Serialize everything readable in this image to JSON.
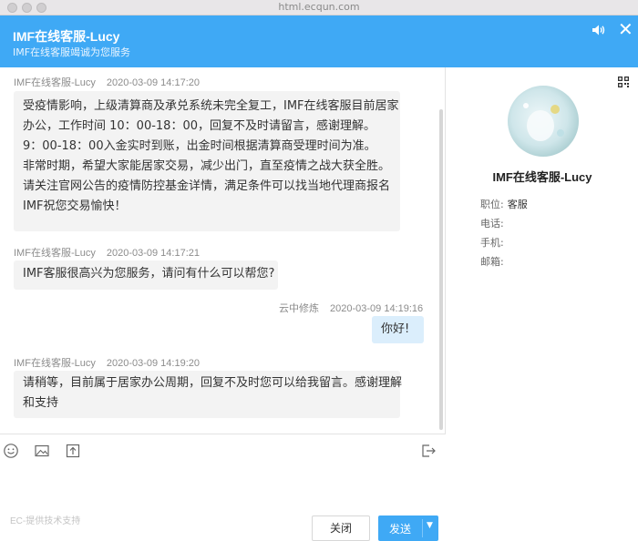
{
  "window": {
    "url": "html.ecqun.com"
  },
  "header": {
    "title": "IMF在线客服-Lucy",
    "subtitle": "IMF在线客服竭诚为您服务",
    "close_glyph": "✕"
  },
  "messages": [
    {
      "sender": "IMF在线客服-Lucy",
      "time": "2020-03-09 14:17:20",
      "lines": [
        "受疫情影响，上级清算商及承兑系统未完全复工，IMF在线客服目前居家",
        "办公，工作时间 10：00-18：00，回复不及时请留言，感谢理解。",
        "9：00-18：00入金实时到账，出金时间根据清算商受理时间为准。",
        "非常时期，希望大家能居家交易，减少出门，直至疫情之战大获全胜。",
        "请关注官网公告的疫情防控基金详情，满足条件可以找当地代理商报名",
        "IMF祝您交易愉快！"
      ]
    },
    {
      "sender": "IMF在线客服-Lucy",
      "time": "2020-03-09 14:17:21",
      "lines": [
        "IMF客服很高兴为您服务，请问有什么可以帮您?"
      ]
    },
    {
      "sender": "云中修炼",
      "time": "2020-03-09 14:19:16",
      "lines": [
        "你好!"
      ]
    },
    {
      "sender": "IMF在线客服-Lucy",
      "time": "2020-03-09 14:19:20",
      "lines": [
        "请稍等，目前属于居家办公周期，回复不及时您可以给我留言。感谢理解",
        "和支持"
      ]
    }
  ],
  "toolbar": {
    "icons": [
      "emoji-icon",
      "image-icon",
      "upload-file-icon",
      "exit-icon"
    ]
  },
  "footer": {
    "powered_by": "EC-提供技术支持",
    "close_label": "关闭",
    "send_label": "发送",
    "send_caret": "▼"
  },
  "profile": {
    "name": "IMF在线客服-Lucy",
    "fields": [
      {
        "label": "职位:",
        "value": "客服"
      },
      {
        "label": "电话:",
        "value": ""
      },
      {
        "label": "手机:",
        "value": ""
      },
      {
        "label": "邮箱:",
        "value": ""
      }
    ]
  },
  "colors": {
    "accent": "#3fa9f5",
    "bubble_agent": "#f3f3f3",
    "bubble_user": "#dbeefc"
  }
}
